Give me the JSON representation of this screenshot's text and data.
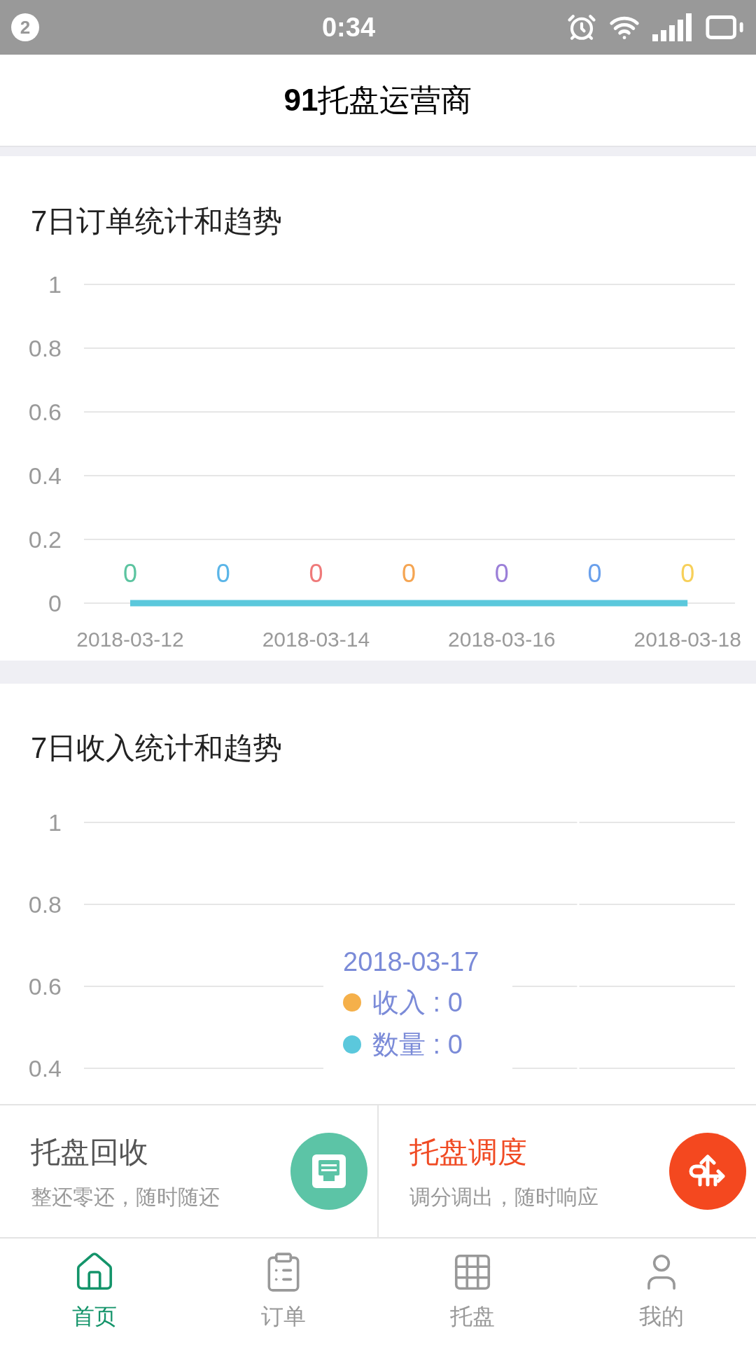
{
  "status_bar": {
    "notification_count": "2",
    "time": "0:34"
  },
  "header": {
    "title": "**91**托盘运营商"
  },
  "order_card": {
    "title": "7日订单统计和趋势",
    "chart_data": {
      "type": "line",
      "categories": [
        "2018-03-12",
        null,
        "2018-03-14",
        null,
        "2018-03-16",
        null,
        "2018-03-18"
      ],
      "series": [
        {
          "color": "#5bc8dc",
          "values": [
            0,
            0,
            0,
            0,
            0,
            0,
            0
          ]
        }
      ],
      "grid": true,
      "ylim": [
        0,
        1
      ],
      "yticks": [
        {
          "value": 0,
          "label": "0"
        },
        {
          "value": 0.2,
          "label": "0.2"
        },
        {
          "value": 0.4,
          "label": "0.4"
        },
        {
          "value": 0.6,
          "label": "0.6"
        },
        {
          "value": 0.8,
          "label": "0.8"
        },
        {
          "value": 1,
          "label": "1"
        }
      ],
      "value_labels": [
        {
          "text": "0",
          "color": "#5cc4a0"
        },
        {
          "text": "0",
          "color": "#5ab5e8"
        },
        {
          "text": "0",
          "color": "#ef7a7a"
        },
        {
          "text": "0",
          "color": "#f5a552"
        },
        {
          "text": "0",
          "color": "#9b7fd8"
        },
        {
          "text": "0",
          "color": "#6aa0ec"
        },
        {
          "text": "0",
          "color": "#f7d05a"
        }
      ]
    }
  },
  "income_card": {
    "title": "7日收入统计和趋势",
    "axis_labels": [
      "1",
      "0.8",
      "0.6",
      "0.4"
    ],
    "tooltip": {
      "date": "2018-03-17",
      "rows": [
        {
          "label": "收入 : 0",
          "color": "#f5b04a"
        },
        {
          "label": "数量 : 0",
          "color": "#5bc8dc"
        }
      ]
    }
  },
  "action_cards": [
    {
      "title": "托盘回收",
      "subtitle": "整还零还，随时随还",
      "highlighted": false,
      "color": "#5cc4a6",
      "kind": "recycle"
    },
    {
      "title": "托盘调度",
      "subtitle": "调分调出，随时响应",
      "highlighted": true,
      "color": "#f4481f",
      "kind": "dispatch"
    }
  ],
  "tabs": [
    {
      "label": "首页",
      "kind": "home",
      "selected": true
    },
    {
      "label": "订单",
      "kind": "orders",
      "selected": false
    },
    {
      "label": "托盘",
      "kind": "pallet",
      "selected": false
    },
    {
      "label": "我的",
      "kind": "profile",
      "selected": false
    }
  ]
}
